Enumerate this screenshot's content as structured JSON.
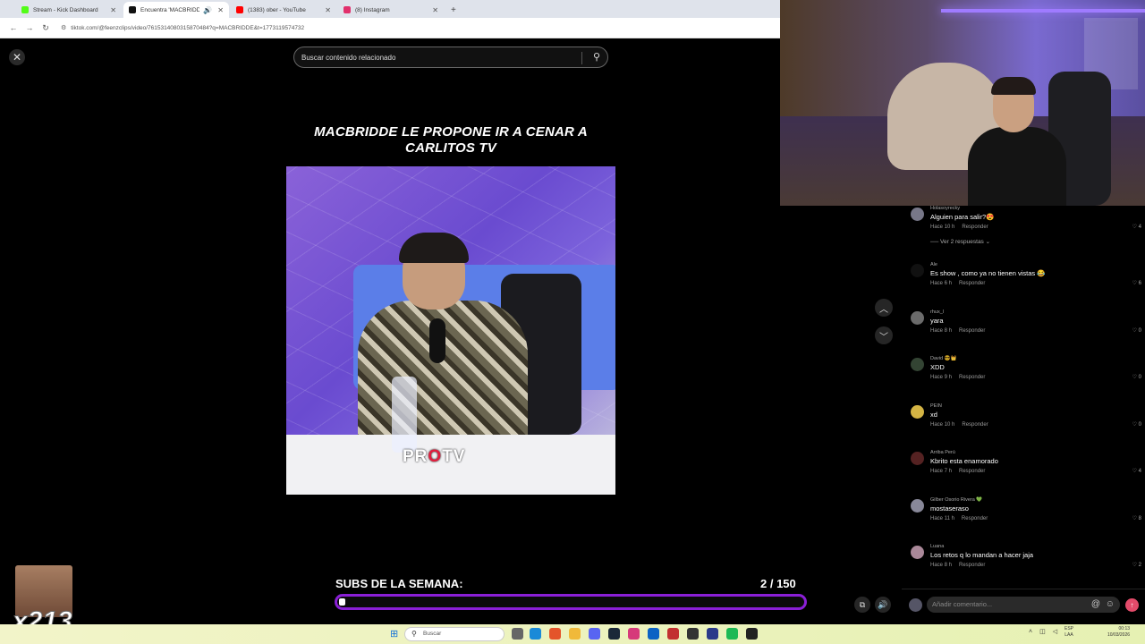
{
  "browser": {
    "tabs": [
      {
        "title": "Stream - Kick Dashboard",
        "color": "#53fc18",
        "active": false
      },
      {
        "title": "Encuentra 'MACBRIDDE' en",
        "color": "#111111",
        "active": true
      },
      {
        "title": "(1383) ober - YouTube",
        "color": "#ff0000",
        "active": false
      },
      {
        "title": "(8) Instagram",
        "color": "#e1306c",
        "active": false
      }
    ],
    "new_tab": "+",
    "url": "tiktok.com/@feenzclips/video/7615314080315870484?q=MACBRIDDE&t=1773119574732"
  },
  "viewer": {
    "search_placeholder": "Buscar contenido relacionado",
    "video_title": "MACBRIDDE LE PROPONE IR A CENAR A CARLITOS TV",
    "logo_text": {
      "before": "PR",
      "o": "O",
      "after": "TV"
    }
  },
  "overlay": {
    "subs_label": "SUBS DE LA SEMANA:",
    "subs_count": "2 / 150",
    "subs_progress": 0.013,
    "meme_counter": "x213"
  },
  "comments": [
    {
      "user": "Holasoyrecky",
      "text": "Alguien para salir?😍",
      "time": "Hace 10 h",
      "reply": "Responder",
      "likes": "4",
      "avatar": "#777788"
    },
    {
      "user": "Ale",
      "text": "Es show , como ya no tienen vistas 😂",
      "time": "Hace 6 h",
      "reply": "Responder",
      "likes": "6",
      "avatar": "#111111"
    },
    {
      "user": "rhux_l",
      "text": "yara",
      "time": "Hace 8 h",
      "reply": "Responder",
      "likes": "0",
      "avatar": "#6b6b6b"
    },
    {
      "user": "David 😎👑",
      "text": "XDD",
      "time": "Hace 9 h",
      "reply": "Responder",
      "likes": "0",
      "avatar": "#334433"
    },
    {
      "user": "PEIN",
      "text": "xd",
      "time": "Hace 10 h",
      "reply": "Responder",
      "likes": "0",
      "avatar": "#d4b444"
    },
    {
      "user": "Arriba Perú",
      "text": "Kbrito esta enamorado",
      "time": "Hace 7 h",
      "reply": "Responder",
      "likes": "4",
      "avatar": "#552222"
    },
    {
      "user": "Gilber Osorio Rivera 💚",
      "text": "mostaseraso",
      "time": "Hace 11 h",
      "reply": "Responder",
      "likes": "8",
      "avatar": "#888899"
    },
    {
      "user": "Luana",
      "text": "Los retos q lo mandan a hacer jaja",
      "time": "Hace 8 h",
      "reply": "Responder",
      "likes": "2",
      "avatar": "#aa8899"
    }
  ],
  "replies_toggle": "Ver 2 respuestas",
  "comment_input_placeholder": "Añadir comentario...",
  "taskbar": {
    "search_placeholder": "Buscar",
    "lang": "ESP",
    "lang_sub": "LAA",
    "time": "00:13",
    "date": "10/03/2026"
  }
}
